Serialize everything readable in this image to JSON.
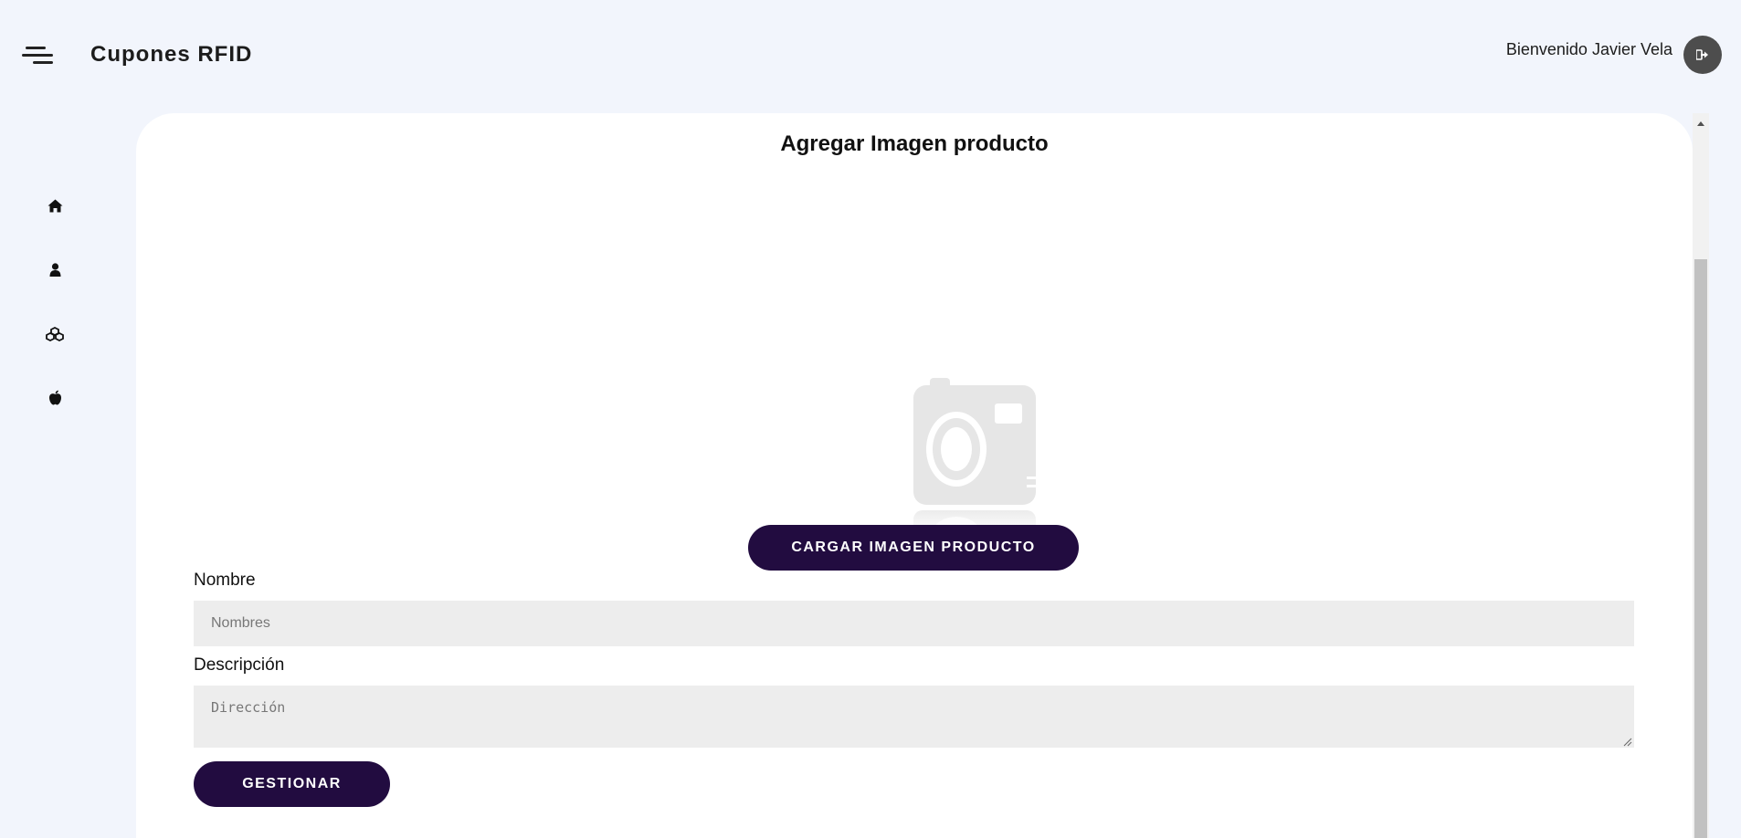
{
  "header": {
    "app_title": "Cupones RFID",
    "welcome_text": "Bienvenido Javier Vela",
    "logout_icon": "logout-icon",
    "menu_icon": "menu-icon"
  },
  "sidebar": {
    "items": [
      {
        "icon": "home-icon"
      },
      {
        "icon": "user-icon"
      },
      {
        "icon": "cubes-icon"
      },
      {
        "icon": "apple-icon"
      }
    ]
  },
  "form": {
    "title": "Agregar Imagen producto",
    "image_placeholder_icon": "camera-icon",
    "upload_button": "CARGAR IMAGEN PRODUCTO",
    "name_label": "Nombre",
    "name_placeholder": "Nombres",
    "name_value": "",
    "description_label": "Descripción",
    "description_placeholder": "Dirección",
    "description_value": "",
    "submit_button": "GESTIONAR"
  },
  "colors": {
    "background": "#f2f5fc",
    "primary_button": "#220c40",
    "input_background": "#ededed",
    "logout_button": "#4d4d4d"
  }
}
